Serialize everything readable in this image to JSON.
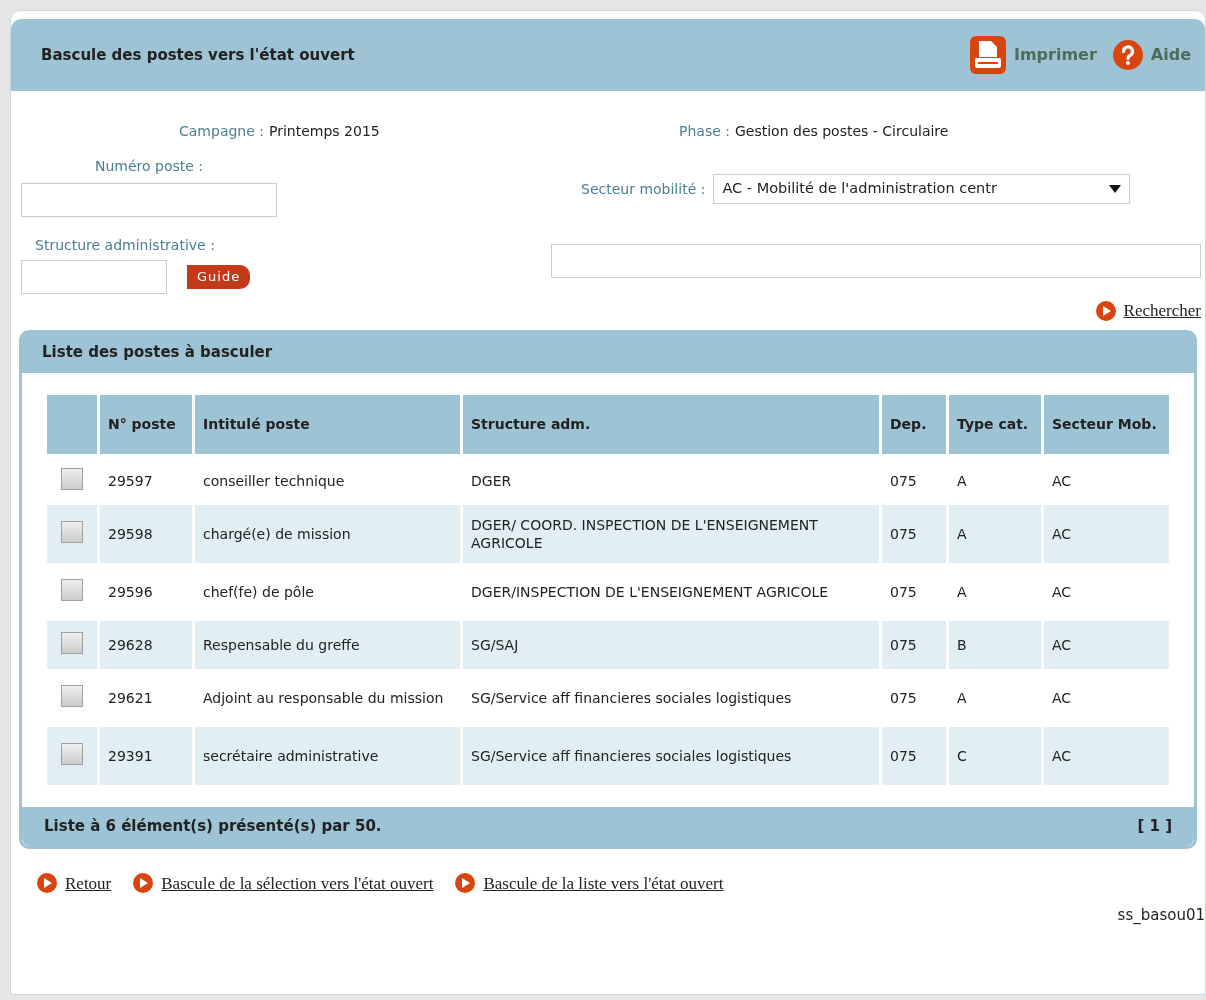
{
  "header": {
    "title": "Bascule des postes vers l'état ouvert",
    "actions": [
      {
        "kind": "print",
        "label": "Imprimer"
      },
      {
        "kind": "help",
        "label": "Aide"
      }
    ]
  },
  "form": {
    "campagne": {
      "label": "Campagne :",
      "value": "Printemps 2015"
    },
    "phase": {
      "label": "Phase :",
      "value": "Gestion des postes - Circulaire"
    },
    "numero_poste": {
      "label": "Numéro poste :"
    },
    "secteur_mobilite": {
      "label": "Secteur mobilité :",
      "value": "AC - Mobilité de l'administration centr"
    },
    "structure": {
      "label": "Structure administrative :",
      "button": "Guide"
    },
    "search_link": "Rechercher"
  },
  "list": {
    "title": "Liste des postes à basculer",
    "columns": [
      "N° poste",
      "Intitulé poste",
      "Structure adm.",
      "Dep.",
      "Type cat.",
      "Secteur Mob."
    ],
    "rows": [
      {
        "checked": false,
        "cells": [
          "29597",
          "conseiller technique",
          "DGER",
          "075",
          "A",
          "AC"
        ]
      },
      {
        "checked": false,
        "cells": [
          "29598",
          "chargé(e) de mission",
          "DGER/ COORD. INSPECTION DE L'ENSEIGNEMENT AGRICOLE",
          "075",
          "A",
          "AC"
        ]
      },
      {
        "checked": false,
        "cells": [
          "29596",
          "chef(fe) de pôle",
          "DGER/INSPECTION DE L'ENSEIGNEMENT AGRICOLE",
          "075",
          "A",
          "AC"
        ]
      },
      {
        "checked": false,
        "cells": [
          "29628",
          "Respensable du greffe",
          "SG/SAJ",
          "075",
          "B",
          "AC"
        ]
      },
      {
        "checked": false,
        "cells": [
          "29621",
          "Adjoint au responsable du mission",
          "SG/Service aff financieres sociales logistiques",
          "075",
          "A",
          "AC"
        ]
      },
      {
        "checked": false,
        "cells": [
          "29391",
          "secrétaire administrative",
          "SG/Service aff financieres sociales logistiques",
          "075",
          "C",
          "AC"
        ]
      }
    ],
    "footer": "Liste à 6 élément(s) présenté(s) par 50.",
    "pages": "[ 1 ]"
  },
  "links": [
    "Retour",
    "Bascule de la sélection vers l'état ouvert",
    "Bascule de la liste vers l'état ouvert"
  ],
  "screen_code": "ss_basou01"
}
